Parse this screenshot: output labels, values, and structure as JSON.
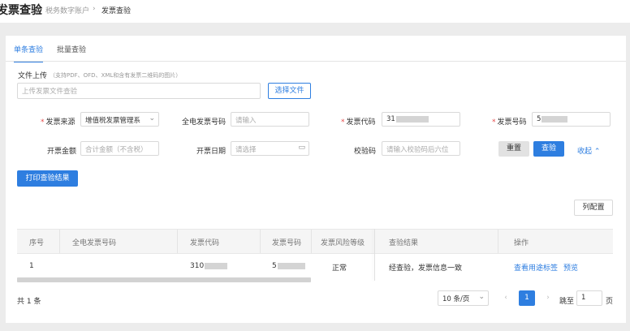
{
  "header": {
    "title": "发票查验",
    "breadcrumb": [
      "税务数字账户",
      "发票查验"
    ],
    "separator": "›"
  },
  "tabs": [
    {
      "label": "单条查验",
      "active": true
    },
    {
      "label": "批量查验",
      "active": false
    }
  ],
  "upload": {
    "label": "文件上传",
    "hint": "（支持PDF、OFD、XML和含有发票二维码的图片）",
    "placeholder": "上传发票文件查验",
    "button": "选择文件"
  },
  "form": {
    "required_mark": "*",
    "source": {
      "label": "发票来源",
      "value": "增值税发票管理系"
    },
    "eticket_no": {
      "label": "全电发票号码",
      "placeholder": "请输入"
    },
    "invoice_code": {
      "label": "发票代码",
      "value": "31"
    },
    "invoice_no": {
      "label": "发票号码",
      "value": "5"
    },
    "amount": {
      "label": "开票金额",
      "placeholder": "合计金额（不含税）"
    },
    "date": {
      "label": "开票日期",
      "placeholder": "请选择"
    },
    "check_code": {
      "label": "校验码",
      "placeholder": "请输入校验码后六位"
    },
    "reset": "重置",
    "query": "查验",
    "collapse": "收起"
  },
  "print_button": "打印查验结果",
  "column_config": "列配置",
  "table": {
    "columns": [
      "序号",
      "全电发票号码",
      "发票代码",
      "发票号码",
      "发票风险等级",
      "查验结果",
      "操作"
    ],
    "rows": [
      {
        "index": "1",
        "eticket": "",
        "code": "310",
        "number": "5",
        "risk": "正常",
        "result": "经查验，发票信息一致",
        "action_view": "查看用途标签",
        "action_preview": "预览"
      }
    ]
  },
  "pagination": {
    "total": "共 1 条",
    "page_size": "10 条/页",
    "current": "1",
    "jump_label": "跳至",
    "jump_value": "1",
    "page_unit": "页"
  },
  "colors": {
    "accent": "#2e7ee0",
    "required": "#e54b4b"
  }
}
